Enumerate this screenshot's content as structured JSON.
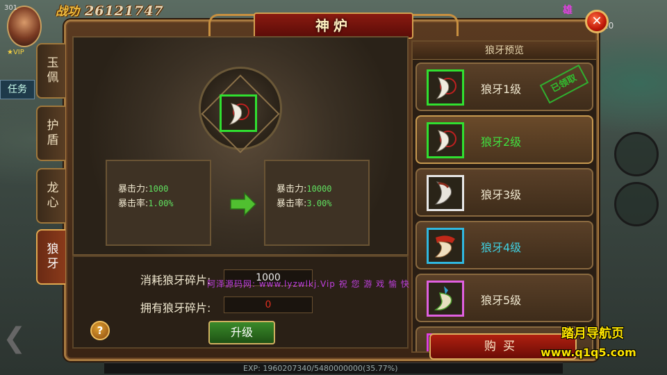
{
  "hud": {
    "level_badge": "301",
    "power_label": "战功",
    "power_value": "26121747",
    "vip_label": "VIP",
    "task_tab": "任务",
    "player_name": "雄",
    "right_text": "20",
    "exp_text": "EXP: 1960207340/5480000000(35.77%)"
  },
  "window": {
    "title": "神炉",
    "close_symbol": "✕"
  },
  "side_tabs": [
    {
      "label": "玉佩",
      "active": false
    },
    {
      "label": "护盾",
      "active": false
    },
    {
      "label": "龙心",
      "active": false
    },
    {
      "label": "狼牙",
      "active": true
    }
  ],
  "current_stats": {
    "crit_power_label": "暴击力:",
    "crit_power_value": "1000",
    "crit_rate_label": "暴击率:",
    "crit_rate_value": "1.00%"
  },
  "next_stats": {
    "crit_power_label": "暴击力:",
    "crit_power_value": "10000",
    "crit_rate_label": "暴击率:",
    "crit_rate_value": "3.00%"
  },
  "cost": {
    "consume_label": "消耗狼牙碎片:",
    "consume_value": "1000",
    "own_label": "拥有狼牙碎片:",
    "own_value": "0"
  },
  "overlay_text": "阿泽源码网: www.lyzwlkj.Vip  祝 您 游 戏 愉 快",
  "buttons": {
    "help": "?",
    "upgrade": "升级",
    "buy": "购买"
  },
  "preview": {
    "title": "狼牙预览",
    "items": [
      {
        "label": "狼牙1级",
        "label_color": "#f0e8d0",
        "frame_color": "#30e030",
        "stamp": "已领取"
      },
      {
        "label": "狼牙2级",
        "label_color": "#40e040",
        "frame_color": "#30e030",
        "stamp": ""
      },
      {
        "label": "狼牙3级",
        "label_color": "#f0e8d0",
        "frame_color": "#e8e8e8",
        "stamp": ""
      },
      {
        "label": "狼牙4级",
        "label_color": "#40d0e0",
        "frame_color": "#30b8e0",
        "stamp": ""
      },
      {
        "label": "狼牙5级",
        "label_color": "#f0e8d0",
        "frame_color": "#e060e0",
        "stamp": ""
      }
    ]
  },
  "site_watermark": {
    "line1": "踏月导航页",
    "line2": "www.q1q5.com"
  },
  "colors": {
    "accent_gold": "#c89a50",
    "stat_green": "#60e060",
    "warning_red": "#e03020"
  }
}
